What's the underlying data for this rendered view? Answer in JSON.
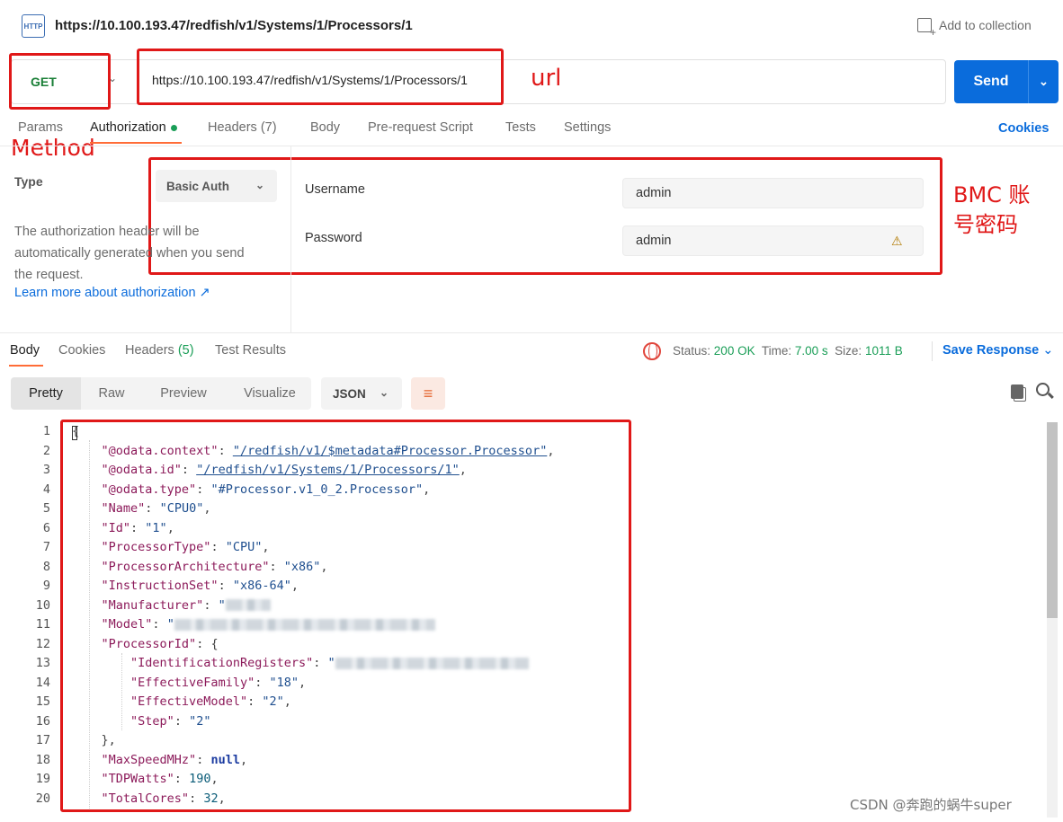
{
  "header": {
    "icon_text": "HTTP",
    "title": "https://10.100.193.47/redfish/v1/Systems/1/Processors/1",
    "add_to_collection": "Add to collection"
  },
  "request": {
    "method": "GET",
    "url": "https://10.100.193.47/redfish/v1/Systems/1/Processors/1",
    "send_label": "Send"
  },
  "tabs": {
    "params": "Params",
    "authorization": "Authorization",
    "headers": "Headers (7)",
    "body": "Body",
    "prerequest": "Pre-request Script",
    "tests": "Tests",
    "settings": "Settings",
    "cookies": "Cookies"
  },
  "auth": {
    "type_label": "Type",
    "type_value": "Basic Auth",
    "desc_1": "The authorization header will be",
    "desc_2": "automatically generated when you send",
    "desc_3": "the request.",
    "learn_more": "Learn more about authorization ↗",
    "username_label": "Username",
    "username_value": "admin",
    "password_label": "Password",
    "password_value": "admin"
  },
  "annotations": {
    "url": "url",
    "method": "Method",
    "bmc_1": "BMC 账",
    "bmc_2": "号密码",
    "watermark": "CSDN @奔跑的蜗牛super"
  },
  "response": {
    "tabs": {
      "body": "Body",
      "cookies": "Cookies",
      "headers": "Headers",
      "headers_count": "(5)",
      "test_results": "Test Results"
    },
    "status_label": "Status:",
    "status_value": "200 OK",
    "time_label": "Time:",
    "time_value": "7.00 s",
    "size_label": "Size:",
    "size_value": "1011 B",
    "save_response": "Save Response",
    "views": {
      "pretty": "Pretty",
      "raw": "Raw",
      "preview": "Preview",
      "visualize": "Visualize"
    },
    "format": "JSON"
  },
  "code": {
    "line_numbers": [
      "1",
      "2",
      "3",
      "4",
      "5",
      "6",
      "7",
      "8",
      "9",
      "10",
      "11",
      "12",
      "13",
      "14",
      "15",
      "16",
      "17",
      "18",
      "19",
      "20"
    ],
    "brace_open": "{",
    "l2_key": "\"@odata.context\"",
    "l2_val": "\"/redfish/v1/$metadata#Processor.Processor\"",
    "l3_key": "\"@odata.id\"",
    "l3_val": "\"/redfish/v1/Systems/1/Processors/1\"",
    "l4_key": "\"@odata.type\"",
    "l4_val": "\"#Processor.v1_0_2.Processor\"",
    "l5_key": "\"Name\"",
    "l5_val": "\"CPU0\"",
    "l6_key": "\"Id\"",
    "l6_val": "\"1\"",
    "l7_key": "\"ProcessorType\"",
    "l7_val": "\"CPU\"",
    "l8_key": "\"ProcessorArchitecture\"",
    "l8_val": "\"x86\"",
    "l9_key": "\"InstructionSet\"",
    "l9_val": "\"x86-64\"",
    "l10_key": "\"Manufacturer\"",
    "l10_val": "\"",
    "l11_key": "\"Model\"",
    "l11_val": "\"",
    "l12_key": "\"ProcessorId\"",
    "l13_key": "\"IdentificationRegisters\"",
    "l13_val": "\"",
    "l14_key": "\"EffectiveFamily\"",
    "l14_val": "\"18\"",
    "l15_key": "\"EffectiveModel\"",
    "l15_val": "\"2\"",
    "l16_key": "\"Step\"",
    "l16_val": "\"2\"",
    "l17": "},",
    "l18_key": "\"MaxSpeedMHz\"",
    "l18_val": "null",
    "l19_key": "\"TDPWatts\"",
    "l19_val": "190",
    "l20_key": "\"TotalCores\"",
    "l20_val": "32"
  }
}
